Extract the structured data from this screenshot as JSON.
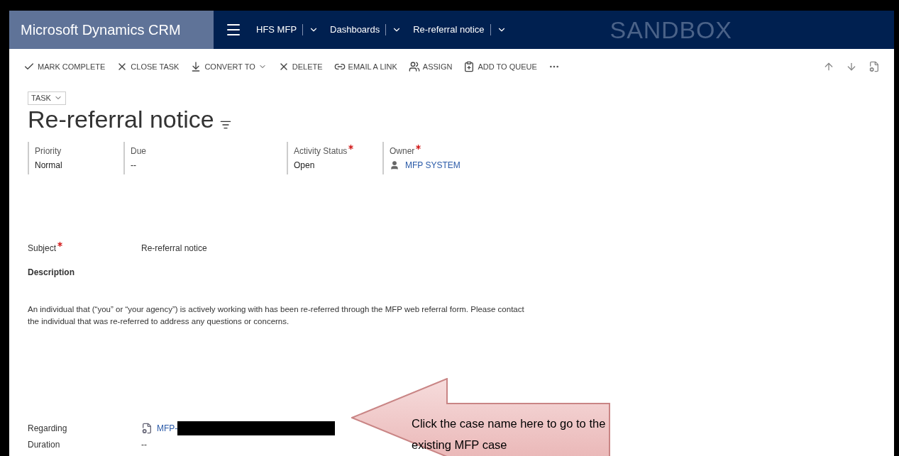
{
  "nav": {
    "brand": "Microsoft Dynamics CRM",
    "crumbs": [
      "HFS MFP",
      "Dashboards",
      "Re-referral notice"
    ],
    "environment": "SANDBOX"
  },
  "toolbar": [
    {
      "label": "MARK COMPLETE",
      "kind": "check"
    },
    {
      "label": "CLOSE TASK",
      "kind": "x"
    },
    {
      "label": "CONVERT TO",
      "kind": "convert",
      "dropdown": true
    },
    {
      "label": "DELETE",
      "kind": "x"
    },
    {
      "label": "EMAIL A LINK",
      "kind": "link"
    },
    {
      "label": "ASSIGN",
      "kind": "assign"
    },
    {
      "label": "ADD TO QUEUE",
      "kind": "queue"
    }
  ],
  "record": {
    "entity": "TASK",
    "title": "Re-referral notice"
  },
  "header_fields": [
    {
      "label": "Priority",
      "value": "Normal",
      "required": false,
      "kind": "text"
    },
    {
      "label": "Due",
      "value": "--",
      "required": false,
      "kind": "text"
    },
    {
      "label": "Activity Status",
      "value": "Open",
      "required": true,
      "kind": "text"
    },
    {
      "label": "Owner",
      "value": "MFP SYSTEM",
      "required": true,
      "kind": "user"
    }
  ],
  "subject": {
    "label": "Subject",
    "value": "Re-referral notice",
    "required": true
  },
  "description": {
    "heading": "Description",
    "text": "An individual that (“you” or “your agency”) is actively working with has been re-referred through the MFP web referral form. Please contact the individual that was re-referred to address any questions or concerns."
  },
  "regarding": {
    "label": "Regarding",
    "value": "MFP-"
  },
  "duration": {
    "label": "Duration",
    "value": "--"
  },
  "callout": {
    "text": "Click the case name here to go to the existing MFP case"
  }
}
